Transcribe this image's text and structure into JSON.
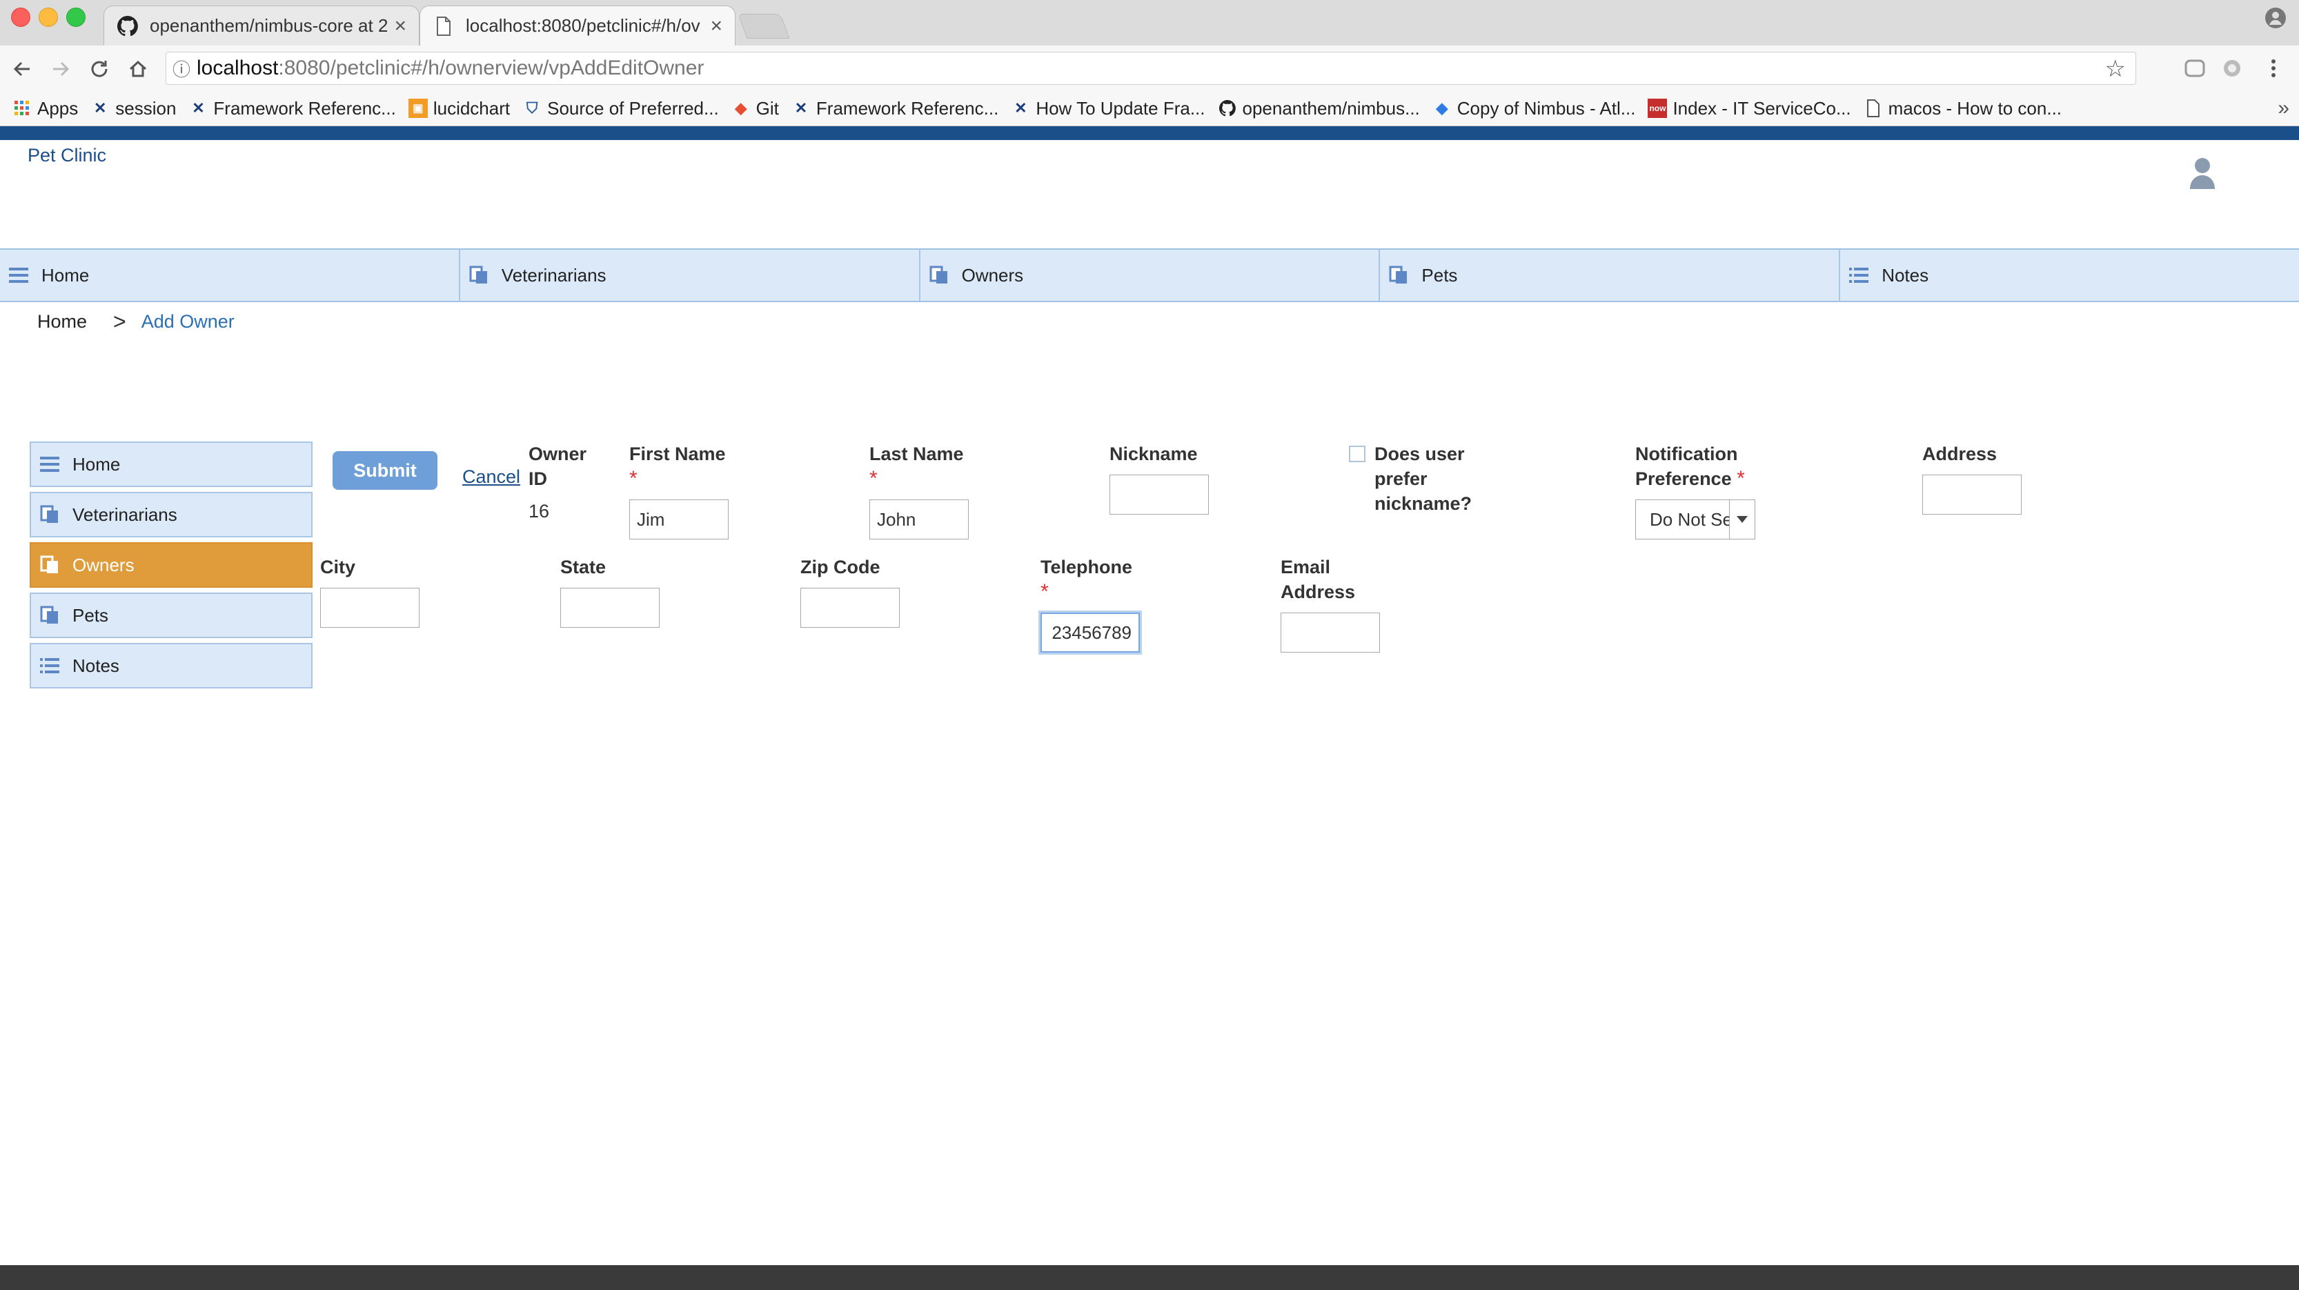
{
  "browser": {
    "tabs": [
      {
        "title": "openanthem/nimbus-core at 2",
        "icon": "github-icon"
      },
      {
        "title": "localhost:8080/petclinic#/h/ov",
        "icon": "document-icon"
      }
    ],
    "url_host": "localhost",
    "url_path": ":8080/petclinic#/h/ownerview/vpAddEditOwner",
    "bookmarks": [
      {
        "label": "Apps",
        "icon": "apps-grid-icon"
      },
      {
        "label": "session",
        "icon": "x-logo-icon"
      },
      {
        "label": "Framework Referenc...",
        "icon": "x-logo-icon"
      },
      {
        "label": "lucidchart",
        "icon": "lucidchart-icon"
      },
      {
        "label": "Source of Preferred...",
        "icon": "shield-icon"
      },
      {
        "label": "Git",
        "icon": "git-icon"
      },
      {
        "label": "Framework Referenc...",
        "icon": "x-logo-icon"
      },
      {
        "label": "How To Update Fra...",
        "icon": "x-logo-icon"
      },
      {
        "label": "openanthem/nimbus...",
        "icon": "github-icon"
      },
      {
        "label": "Copy of Nimbus - Atl...",
        "icon": "diamond-icon"
      },
      {
        "label": "Index - IT ServiceCo...",
        "icon": "now-icon"
      },
      {
        "label": "macos - How to con...",
        "icon": "document-icon"
      }
    ],
    "more_symbol": "»"
  },
  "app": {
    "title": "Pet Clinic",
    "accent_color": "#1b4f8a",
    "active_color": "#e09b3b"
  },
  "topnav": [
    {
      "label": "Home",
      "icon": "list-icon"
    },
    {
      "label": "Veterinarians",
      "icon": "pages-icon"
    },
    {
      "label": "Owners",
      "icon": "pages-icon"
    },
    {
      "label": "Pets",
      "icon": "pages-icon"
    },
    {
      "label": "Notes",
      "icon": "list-icon"
    }
  ],
  "breadcrumb": {
    "home": "Home",
    "separator": ">",
    "current": "Add Owner"
  },
  "sidemenu": [
    {
      "label": "Home",
      "icon": "list-icon",
      "active": false
    },
    {
      "label": "Veterinarians",
      "icon": "pages-icon",
      "active": false
    },
    {
      "label": "Owners",
      "icon": "pages-icon",
      "active": true
    },
    {
      "label": "Pets",
      "icon": "pages-icon",
      "active": false
    },
    {
      "label": "Notes",
      "icon": "list-icon",
      "active": false
    }
  ],
  "form": {
    "submit_label": "Submit",
    "cancel_label": "Cancel",
    "required_mark": "*",
    "owner_id_label_1": "Owner",
    "owner_id_label_2": "ID",
    "owner_id_value": "16",
    "first_name_label": "First Name",
    "first_name_value": "Jim",
    "last_name_label": "Last Name",
    "last_name_value": "John",
    "nickname_label": "Nickname",
    "nickname_value": "",
    "prefer_nickname_label_1": "Does user",
    "prefer_nickname_label_2": "prefer",
    "prefer_nickname_label_3": "nickname?",
    "notification_label_1": "Notification",
    "notification_label_2": "Preference",
    "notification_value": "Do Not Se",
    "address_label": "Address",
    "address_value": "",
    "city_label": "City",
    "city_value": "",
    "state_label": "State",
    "state_value": "",
    "zip_label": "Zip Code",
    "zip_value": "",
    "telephone_label": "Telephone",
    "telephone_value": "23456789",
    "email_label_1": "Email",
    "email_label_2": "Address",
    "email_value": ""
  }
}
